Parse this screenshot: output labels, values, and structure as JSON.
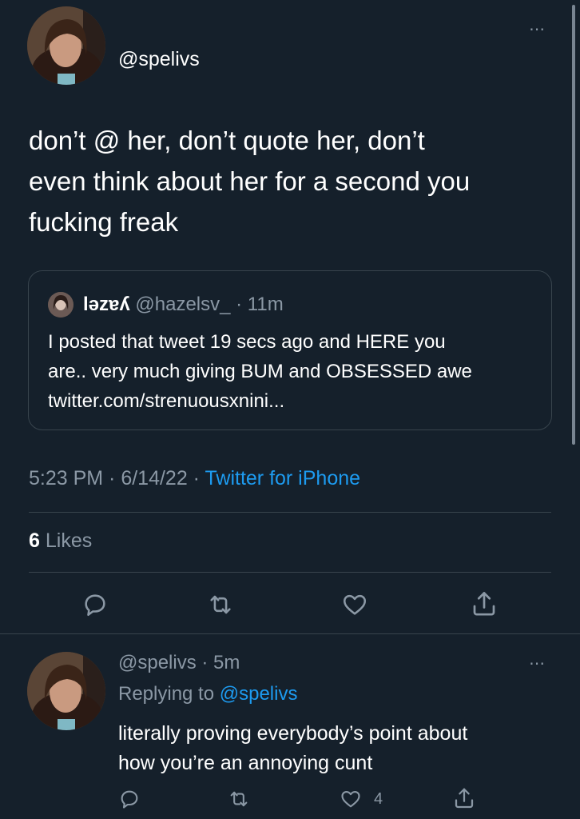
{
  "main_tweet": {
    "handle": "@spelivs",
    "text_lines": [
      "don’t @ her, don’t quote her, don’t",
      "even think about her for a second you",
      "fucking freak"
    ],
    "quote": {
      "name": "ləzɐʎ",
      "handle_time": "@hazelsv_ · 11m",
      "text_lines": [
        "I posted that tweet 19 secs ago and HERE you",
        "are.. very much giving BUM and OBSESSED awe",
        "twitter.com/strenuousxnini..."
      ]
    },
    "timestamp": "5:23 PM · 6/14/22 · ",
    "source": "Twitter for iPhone",
    "likes_count": "6",
    "likes_label": "Likes"
  },
  "reply_tweet": {
    "handle_time": "@spelivs · 5m",
    "replying_prefix": "Replying to ",
    "replying_to": "@spelivs",
    "text_lines": [
      "literally proving everybody’s point about",
      "how you’re an annoying cunt"
    ],
    "like_count": "4"
  },
  "icons": {
    "more": "⋯",
    "reply": "reply-icon",
    "retweet": "retweet-icon",
    "like": "heart-icon",
    "share": "share-icon"
  },
  "colors": {
    "background": "#15202b",
    "secondary_text": "#8b98a5",
    "accent": "#1d9bf0",
    "border": "#38444d"
  }
}
